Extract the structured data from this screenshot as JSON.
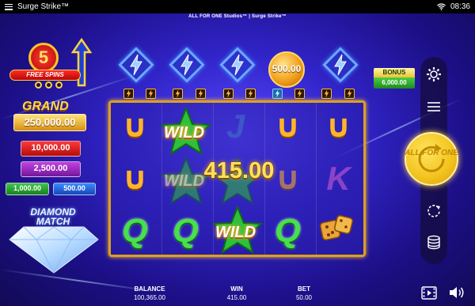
{
  "status_bar": {
    "title": "Surge Strike™",
    "wifi_icon": "wifi-icon",
    "time": "08:36"
  },
  "studio": "ALL FOR ONE Studios™ | Surge Strike™",
  "free_spins": {
    "count": "5",
    "label": "FREE SPINS"
  },
  "jackpots": {
    "grand_title": "GRAND",
    "grand": "250,000.00",
    "major": "10,000.00",
    "minor": "2,500.00",
    "mini": "1,000.00",
    "mini2": "500.00"
  },
  "diamond_match": "DIAMOND MATCH",
  "coin_value": "500.00",
  "bonus": {
    "label": "BONUS",
    "value": "6,000.00"
  },
  "win_amount": "415.00",
  "wild_text": "WILD",
  "reel_symbols": {
    "horseshoe": "∪",
    "J": "J",
    "K": "K",
    "Q": "Q"
  },
  "spin_button": {
    "label": "ALL FOR ONE"
  },
  "bottom": {
    "balance_label": "BALANCE",
    "balance": "100,365.00",
    "win_label": "WIN",
    "win": "415.00",
    "bet_label": "BET",
    "bet": "50.00"
  },
  "colors": {
    "reel_frame": "#d9a11f",
    "grand": "#ffd84a",
    "major": "#d11c1c",
    "minor": "#9627c2",
    "mini": "#2aa436",
    "mini2": "#2361d6"
  }
}
